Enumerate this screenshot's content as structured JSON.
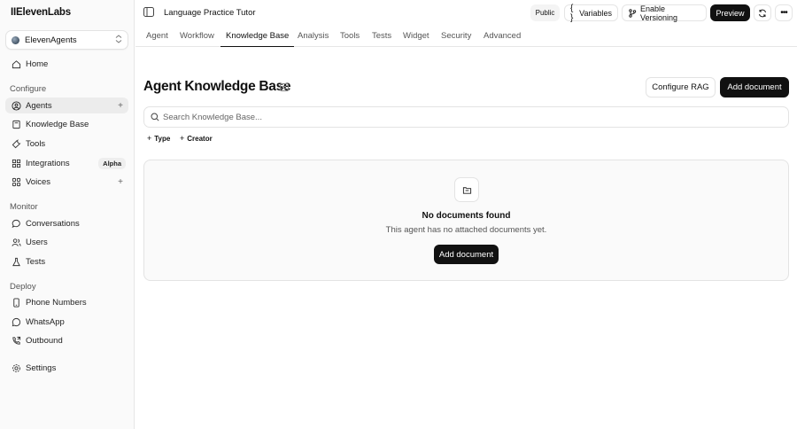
{
  "app": {
    "logo": "IIElevenLabs"
  },
  "workspace": {
    "name": "ElevenAgents",
    "icon": "chevron-up-down-icon"
  },
  "sidebar": {
    "home": {
      "label": "Home",
      "icon": "home-icon"
    },
    "sections": {
      "configure": "Configure",
      "monitor": "Monitor",
      "deploy": "Deploy"
    },
    "configure_items": [
      {
        "label": "Agents",
        "icon": "agent-icon",
        "active": true,
        "plus": "+"
      },
      {
        "label": "Knowledge Base",
        "icon": "book-icon"
      },
      {
        "label": "Tools",
        "icon": "wrench-icon"
      },
      {
        "label": "Integrations",
        "icon": "grid-icon",
        "badge": "Alpha"
      },
      {
        "label": "Voices",
        "icon": "voice-icon",
        "plus": "+"
      }
    ],
    "monitor_items": [
      {
        "label": "Conversations",
        "icon": "chat-icon"
      },
      {
        "label": "Users",
        "icon": "users-icon"
      },
      {
        "label": "Tests",
        "icon": "flask-icon"
      }
    ],
    "deploy_items": [
      {
        "label": "Phone Numbers",
        "icon": "phone-icon"
      },
      {
        "label": "WhatsApp",
        "icon": "whatsapp-icon"
      },
      {
        "label": "Outbound",
        "icon": "outbound-call-icon"
      }
    ],
    "settings": {
      "label": "Settings",
      "icon": "gear-icon"
    }
  },
  "topbar": {
    "agent_name": "Language Practice Tutor",
    "public_label": "Public",
    "variables_label": "Variables",
    "versioning_label": "Enable Versioning",
    "preview_label": "Preview"
  },
  "tabs": [
    "Agent",
    "Workflow",
    "Knowledge Base",
    "Analysis",
    "Tools",
    "Tests",
    "Widget",
    "Security",
    "Advanced"
  ],
  "active_tab": "Knowledge Base",
  "main": {
    "title": "Agent Knowledge Base",
    "configure_rag_label": "Configure RAG",
    "add_document_label": "Add document",
    "search_placeholder": "Search Knowledge Base...",
    "filters": [
      "Type",
      "Creator"
    ],
    "empty": {
      "title": "No documents found",
      "description": "This agent has no attached documents yet.",
      "button_label": "Add document"
    }
  }
}
